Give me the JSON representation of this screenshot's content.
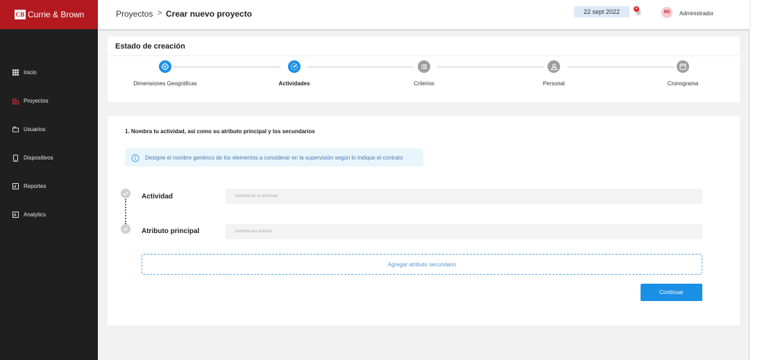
{
  "brand": {
    "logo_mark": "CB",
    "name": "Currie & Brown",
    "color": "#b3191f"
  },
  "sidebar": {
    "items": [
      {
        "label": "Inicio",
        "icon": "grid-icon",
        "active": false
      },
      {
        "label": "Proyectos",
        "icon": "building-icon",
        "active": true
      },
      {
        "label": "Usuarios",
        "icon": "users-icon",
        "active": false
      },
      {
        "label": "Dispositivos",
        "icon": "device-icon",
        "active": false
      },
      {
        "label": "Reportes",
        "icon": "report-icon",
        "active": false
      },
      {
        "label": "Analytics",
        "icon": "analytics-icon",
        "active": false
      }
    ]
  },
  "header": {
    "breadcrumb_root": "Proyectos",
    "breadcrumb_sep": ">",
    "breadcrumb_current": "Crear nuevo proyecto",
    "date": "22 sept 2022",
    "notification_count": "4",
    "user_initials": "RS",
    "user_name": "Administrador"
  },
  "steps": {
    "title": "Estado de creación",
    "items": [
      {
        "label": "Dimensiones Geográficas",
        "icon": "location-icon",
        "state": "done"
      },
      {
        "label": "Actividades",
        "icon": "activity-icon",
        "state": "current"
      },
      {
        "label": "Criterios",
        "icon": "list-icon",
        "state": "pending"
      },
      {
        "label": "Personal",
        "icon": "person-icon",
        "state": "pending"
      },
      {
        "label": "Cronograma",
        "icon": "calendar-icon",
        "state": "pending"
      }
    ],
    "colors": {
      "active": "#1a8fe6",
      "pending": "#9e9e9e"
    }
  },
  "form": {
    "heading": "1. Nombra tu actividad, así como su atributo principal y los secundarios",
    "info": "Designe el nombre genérico de los elementos a considerar en la supervisión según lo indique el contrato",
    "activity_label": "Actividad",
    "activity_placeholder": "Nombre de la actividad",
    "attribute_label": "Atributo principal",
    "attribute_placeholder": "Nombre del atributo",
    "add_secondary_label": "Agregar atributo secundario",
    "continue_label": "Continuar"
  }
}
